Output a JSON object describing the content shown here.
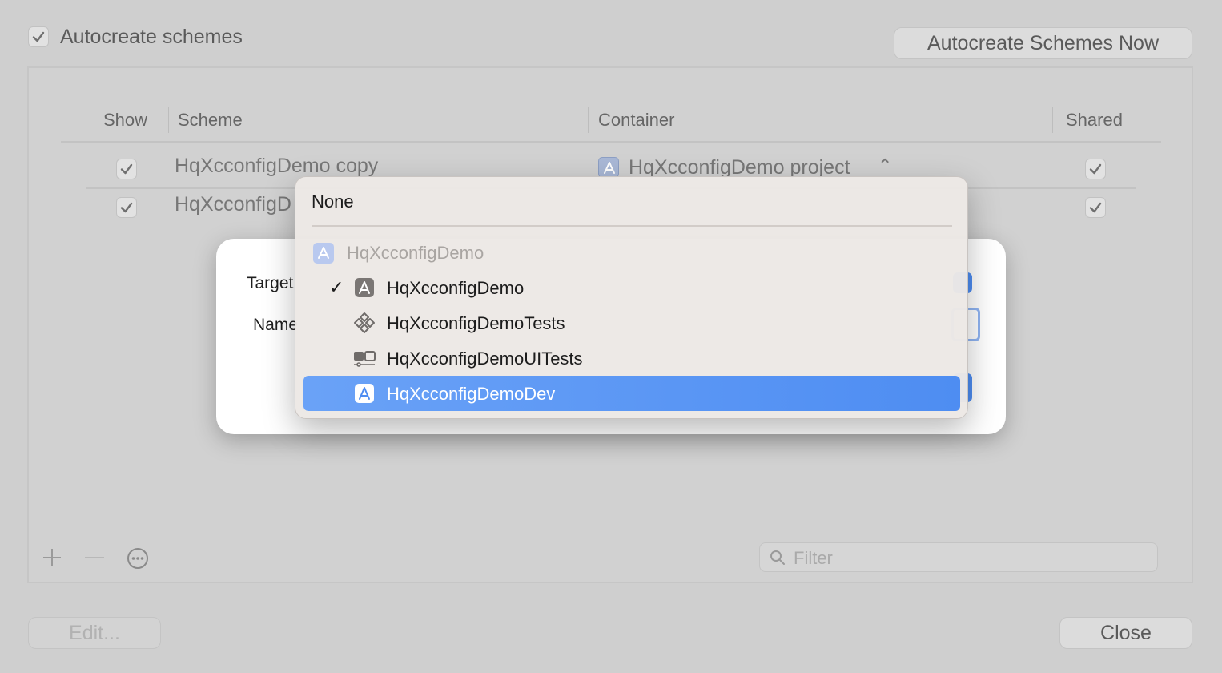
{
  "window": {
    "autocreate_label": "Autocreate schemes",
    "autocreate_checked": true,
    "autocreate_now_button": "Autocreate Schemes Now",
    "edit_button": "Edit...",
    "close_button": "Close",
    "filter_placeholder": "Filter"
  },
  "table": {
    "columns": [
      "Show",
      "Scheme",
      "Container",
      "Shared"
    ],
    "rows": [
      {
        "show": true,
        "scheme": "HqXcconfigDemo copy",
        "container": "HqXcconfigDemo project",
        "shared": true
      },
      {
        "show": true,
        "scheme": "HqXcconfigD",
        "container": "",
        "shared": true
      }
    ]
  },
  "dialog": {
    "target_label": "Target",
    "name_label": "Name"
  },
  "menu": {
    "none_label": "None",
    "group_label": "HqXcconfigDemo",
    "items": [
      {
        "label": "HqXcconfigDemo",
        "icon": "app-target-icon",
        "checked": true
      },
      {
        "label": "HqXcconfigDemoTests",
        "icon": "unit-test-icon",
        "checked": false
      },
      {
        "label": "HqXcconfigDemoUITests",
        "icon": "ui-test-icon",
        "checked": false
      },
      {
        "label": "HqXcconfigDemoDev",
        "icon": "app-target-icon",
        "checked": false,
        "highlighted": true
      }
    ],
    "check_glyph": "✓"
  },
  "colors": {
    "accent": "#4e8df2",
    "menu_bg": "#ece8e5",
    "dialog_bg": "#ffffff"
  }
}
